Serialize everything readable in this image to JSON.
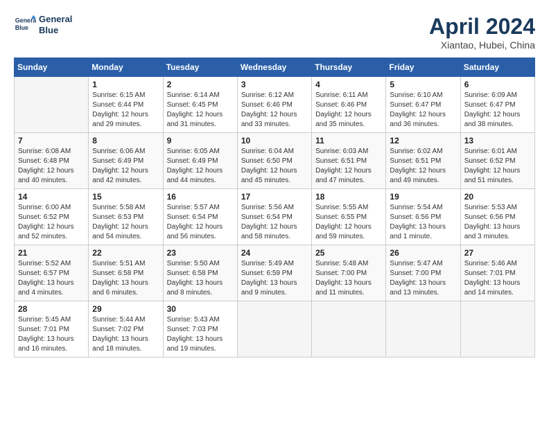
{
  "header": {
    "logo_line1": "General",
    "logo_line2": "Blue",
    "month_year": "April 2024",
    "location": "Xiantao, Hubei, China"
  },
  "days_of_week": [
    "Sunday",
    "Monday",
    "Tuesday",
    "Wednesday",
    "Thursday",
    "Friday",
    "Saturday"
  ],
  "weeks": [
    [
      {
        "day": "",
        "info": ""
      },
      {
        "day": "1",
        "info": "Sunrise: 6:15 AM\nSunset: 6:44 PM\nDaylight: 12 hours\nand 29 minutes."
      },
      {
        "day": "2",
        "info": "Sunrise: 6:14 AM\nSunset: 6:45 PM\nDaylight: 12 hours\nand 31 minutes."
      },
      {
        "day": "3",
        "info": "Sunrise: 6:12 AM\nSunset: 6:46 PM\nDaylight: 12 hours\nand 33 minutes."
      },
      {
        "day": "4",
        "info": "Sunrise: 6:11 AM\nSunset: 6:46 PM\nDaylight: 12 hours\nand 35 minutes."
      },
      {
        "day": "5",
        "info": "Sunrise: 6:10 AM\nSunset: 6:47 PM\nDaylight: 12 hours\nand 36 minutes."
      },
      {
        "day": "6",
        "info": "Sunrise: 6:09 AM\nSunset: 6:47 PM\nDaylight: 12 hours\nand 38 minutes."
      }
    ],
    [
      {
        "day": "7",
        "info": "Sunrise: 6:08 AM\nSunset: 6:48 PM\nDaylight: 12 hours\nand 40 minutes."
      },
      {
        "day": "8",
        "info": "Sunrise: 6:06 AM\nSunset: 6:49 PM\nDaylight: 12 hours\nand 42 minutes."
      },
      {
        "day": "9",
        "info": "Sunrise: 6:05 AM\nSunset: 6:49 PM\nDaylight: 12 hours\nand 44 minutes."
      },
      {
        "day": "10",
        "info": "Sunrise: 6:04 AM\nSunset: 6:50 PM\nDaylight: 12 hours\nand 45 minutes."
      },
      {
        "day": "11",
        "info": "Sunrise: 6:03 AM\nSunset: 6:51 PM\nDaylight: 12 hours\nand 47 minutes."
      },
      {
        "day": "12",
        "info": "Sunrise: 6:02 AM\nSunset: 6:51 PM\nDaylight: 12 hours\nand 49 minutes."
      },
      {
        "day": "13",
        "info": "Sunrise: 6:01 AM\nSunset: 6:52 PM\nDaylight: 12 hours\nand 51 minutes."
      }
    ],
    [
      {
        "day": "14",
        "info": "Sunrise: 6:00 AM\nSunset: 6:52 PM\nDaylight: 12 hours\nand 52 minutes."
      },
      {
        "day": "15",
        "info": "Sunrise: 5:58 AM\nSunset: 6:53 PM\nDaylight: 12 hours\nand 54 minutes."
      },
      {
        "day": "16",
        "info": "Sunrise: 5:57 AM\nSunset: 6:54 PM\nDaylight: 12 hours\nand 56 minutes."
      },
      {
        "day": "17",
        "info": "Sunrise: 5:56 AM\nSunset: 6:54 PM\nDaylight: 12 hours\nand 58 minutes."
      },
      {
        "day": "18",
        "info": "Sunrise: 5:55 AM\nSunset: 6:55 PM\nDaylight: 12 hours\nand 59 minutes."
      },
      {
        "day": "19",
        "info": "Sunrise: 5:54 AM\nSunset: 6:56 PM\nDaylight: 13 hours\nand 1 minute."
      },
      {
        "day": "20",
        "info": "Sunrise: 5:53 AM\nSunset: 6:56 PM\nDaylight: 13 hours\nand 3 minutes."
      }
    ],
    [
      {
        "day": "21",
        "info": "Sunrise: 5:52 AM\nSunset: 6:57 PM\nDaylight: 13 hours\nand 4 minutes."
      },
      {
        "day": "22",
        "info": "Sunrise: 5:51 AM\nSunset: 6:58 PM\nDaylight: 13 hours\nand 6 minutes."
      },
      {
        "day": "23",
        "info": "Sunrise: 5:50 AM\nSunset: 6:58 PM\nDaylight: 13 hours\nand 8 minutes."
      },
      {
        "day": "24",
        "info": "Sunrise: 5:49 AM\nSunset: 6:59 PM\nDaylight: 13 hours\nand 9 minutes."
      },
      {
        "day": "25",
        "info": "Sunrise: 5:48 AM\nSunset: 7:00 PM\nDaylight: 13 hours\nand 11 minutes."
      },
      {
        "day": "26",
        "info": "Sunrise: 5:47 AM\nSunset: 7:00 PM\nDaylight: 13 hours\nand 13 minutes."
      },
      {
        "day": "27",
        "info": "Sunrise: 5:46 AM\nSunset: 7:01 PM\nDaylight: 13 hours\nand 14 minutes."
      }
    ],
    [
      {
        "day": "28",
        "info": "Sunrise: 5:45 AM\nSunset: 7:01 PM\nDaylight: 13 hours\nand 16 minutes."
      },
      {
        "day": "29",
        "info": "Sunrise: 5:44 AM\nSunset: 7:02 PM\nDaylight: 13 hours\nand 18 minutes."
      },
      {
        "day": "30",
        "info": "Sunrise: 5:43 AM\nSunset: 7:03 PM\nDaylight: 13 hours\nand 19 minutes."
      },
      {
        "day": "",
        "info": ""
      },
      {
        "day": "",
        "info": ""
      },
      {
        "day": "",
        "info": ""
      },
      {
        "day": "",
        "info": ""
      }
    ]
  ]
}
